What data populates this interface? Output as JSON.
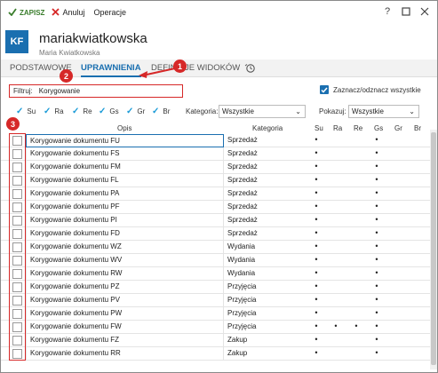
{
  "toolbar": {
    "save_label": "ZAPISZ",
    "cancel_label": "Anuluj",
    "ops_label": "Operacje",
    "help": "?",
    "colors": {
      "save": "#3a7d2c",
      "cancel": "#d62828"
    }
  },
  "header": {
    "initials": "KF",
    "login": "mariakwiatkowska",
    "full_name": "Maria Kwiatkowska",
    "avatar_color": "#1a6fb0"
  },
  "tabs": [
    {
      "label": "PODSTAWOWE"
    },
    {
      "label": "UPRAWNIENIA",
      "active": true
    },
    {
      "label": "DEFINICJE WIDOKÓW"
    }
  ],
  "filter": {
    "label": "Filtruj:",
    "value": "Korygowanie"
  },
  "select_all_label": "Zaznacz/odznacz wszystkie",
  "flags": [
    "Su",
    "Ra",
    "Re",
    "Gs",
    "Gr",
    "Br"
  ],
  "category_filter": {
    "label": "Kategoria:",
    "value": "Wszystkie"
  },
  "show_filter": {
    "label": "Pokazuj:",
    "value": "Wszystkie"
  },
  "table": {
    "headers": [
      "Opis",
      "Kategoria",
      "Su",
      "Ra",
      "Re",
      "Gs",
      "Gr",
      "Br"
    ],
    "rows": [
      {
        "opis": "Korygowanie dokumentu FU",
        "kategoria": "Sprzedaż",
        "su": "•",
        "ra": "",
        "re": "",
        "gs": "•",
        "gr": "",
        "br": ""
      },
      {
        "opis": "Korygowanie dokumentu FS",
        "kategoria": "Sprzedaż",
        "su": "•",
        "ra": "",
        "re": "",
        "gs": "•",
        "gr": "",
        "br": ""
      },
      {
        "opis": "Korygowanie dokumentu FM",
        "kategoria": "Sprzedaż",
        "su": "•",
        "ra": "",
        "re": "",
        "gs": "•",
        "gr": "",
        "br": ""
      },
      {
        "opis": "Korygowanie dokumentu FL",
        "kategoria": "Sprzedaż",
        "su": "•",
        "ra": "",
        "re": "",
        "gs": "•",
        "gr": "",
        "br": ""
      },
      {
        "opis": "Korygowanie dokumentu PA",
        "kategoria": "Sprzedaż",
        "su": "•",
        "ra": "",
        "re": "",
        "gs": "•",
        "gr": "",
        "br": ""
      },
      {
        "opis": "Korygowanie dokumentu PF",
        "kategoria": "Sprzedaż",
        "su": "•",
        "ra": "",
        "re": "",
        "gs": "•",
        "gr": "",
        "br": ""
      },
      {
        "opis": "Korygowanie dokumentu PI",
        "kategoria": "Sprzedaż",
        "su": "•",
        "ra": "",
        "re": "",
        "gs": "•",
        "gr": "",
        "br": ""
      },
      {
        "opis": "Korygowanie dokumentu FD",
        "kategoria": "Sprzedaż",
        "su": "•",
        "ra": "",
        "re": "",
        "gs": "•",
        "gr": "",
        "br": ""
      },
      {
        "opis": "Korygowanie dokumentu WZ",
        "kategoria": "Wydania",
        "su": "•",
        "ra": "",
        "re": "",
        "gs": "•",
        "gr": "",
        "br": ""
      },
      {
        "opis": "Korygowanie dokumentu WV",
        "kategoria": "Wydania",
        "su": "•",
        "ra": "",
        "re": "",
        "gs": "•",
        "gr": "",
        "br": ""
      },
      {
        "opis": "Korygowanie dokumentu RW",
        "kategoria": "Wydania",
        "su": "•",
        "ra": "",
        "re": "",
        "gs": "•",
        "gr": "",
        "br": ""
      },
      {
        "opis": "Korygowanie dokumentu PZ",
        "kategoria": "Przyjęcia",
        "su": "•",
        "ra": "",
        "re": "",
        "gs": "•",
        "gr": "",
        "br": ""
      },
      {
        "opis": "Korygowanie dokumentu PV",
        "kategoria": "Przyjęcia",
        "su": "•",
        "ra": "",
        "re": "",
        "gs": "•",
        "gr": "",
        "br": ""
      },
      {
        "opis": "Korygowanie dokumentu PW",
        "kategoria": "Przyjęcia",
        "su": "•",
        "ra": "",
        "re": "",
        "gs": "•",
        "gr": "",
        "br": ""
      },
      {
        "opis": "Korygowanie dokumentu FW",
        "kategoria": "Przyjęcia",
        "su": "•",
        "ra": "•",
        "re": "•",
        "gs": "•",
        "gr": "",
        "br": ""
      },
      {
        "opis": "Korygowanie dokumentu FZ",
        "kategoria": "Zakup",
        "su": "•",
        "ra": "",
        "re": "",
        "gs": "•",
        "gr": "",
        "br": ""
      },
      {
        "opis": "Korygowanie dokumentu RR",
        "kategoria": "Zakup",
        "su": "•",
        "ra": "",
        "re": "",
        "gs": "•",
        "gr": "",
        "br": ""
      }
    ]
  },
  "callouts": [
    "1",
    "2",
    "3"
  ],
  "accent_color": "#1a6fb0",
  "annotation_color": "#d62828"
}
